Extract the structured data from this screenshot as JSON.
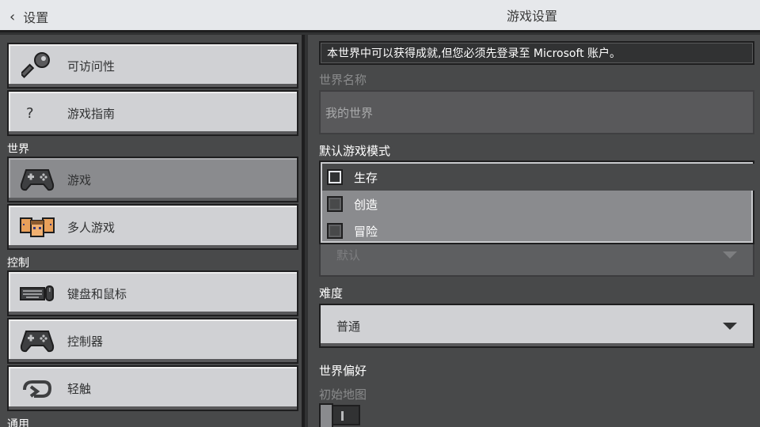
{
  "header": {
    "back_label": "设置",
    "title": "游戏设置"
  },
  "sidebar": {
    "top_items": [
      {
        "label": "可访问性",
        "icon": "key-icon"
      },
      {
        "label": "游戏指南",
        "icon": "question-icon",
        "glyph": "?"
      }
    ],
    "sections": [
      {
        "title": "世界",
        "items": [
          {
            "label": "游戏",
            "icon": "controller-icon",
            "active": true
          },
          {
            "label": "多人游戏",
            "icon": "multiplayer-faces-icon"
          }
        ]
      },
      {
        "title": "控制",
        "items": [
          {
            "label": "键盘和鼠标",
            "icon": "keyboard-mouse-icon"
          },
          {
            "label": "控制器",
            "icon": "controller-icon"
          },
          {
            "label": "轻触",
            "icon": "touch-hand-icon"
          }
        ]
      },
      {
        "title": "通用",
        "items": []
      }
    ]
  },
  "main": {
    "notice": "本世界中可以获得成就,但您必须先登录至 Microsoft 账户。",
    "world_name_label": "世界名称",
    "world_name_value": "我的世界",
    "game_mode_label": "默认游戏模式",
    "game_mode_current": "默认",
    "game_mode_options": [
      {
        "label": "生存",
        "selected": true
      },
      {
        "label": "创造",
        "selected": false
      },
      {
        "label": "冒险",
        "selected": false
      }
    ],
    "difficulty_label": "难度",
    "difficulty_value": "普通",
    "world_prefs_label": "世界偏好",
    "starter_map_label": "初始地图"
  },
  "colors": {
    "panel": "#48494a",
    "button": "#d0d1d4",
    "button_active": "#8a8b8e",
    "dark": "#313233",
    "outline": "#1e1e1f"
  }
}
